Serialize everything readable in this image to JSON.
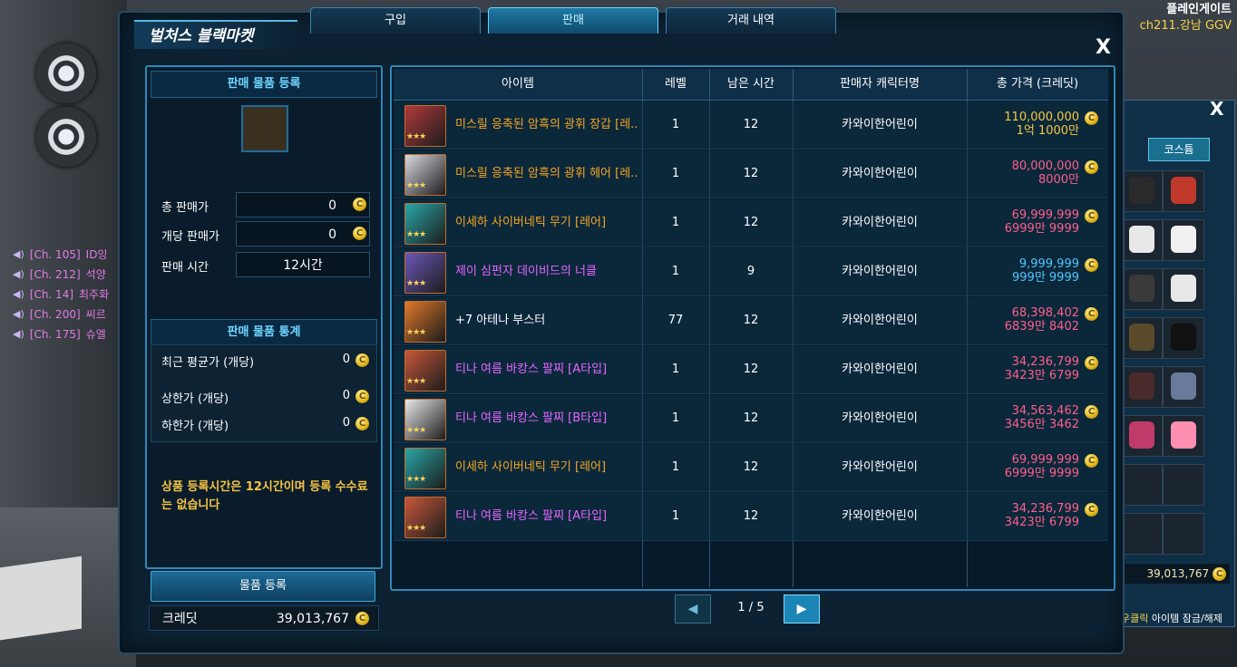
{
  "server": {
    "name": "플레인게이트",
    "channel": "ch211.강남 GGV"
  },
  "chat": [
    {
      "tag": "[Ch. 105]",
      "text": "ID잉"
    },
    {
      "tag": "[Ch. 212]",
      "text": "석양"
    },
    {
      "tag": "[Ch. 14]",
      "text": "최주화"
    },
    {
      "tag": "[Ch. 200]",
      "text": "씨르"
    },
    {
      "tag": "[Ch. 175]",
      "text": "슈엘"
    }
  ],
  "window": {
    "title": "벌처스 블랙마켓",
    "close": "X"
  },
  "tabs": [
    {
      "label": "구입"
    },
    {
      "label": "판매"
    },
    {
      "label": "거래 내역"
    }
  ],
  "left": {
    "register_header": "판매 물품 등록",
    "total_price_label": "총 판매가",
    "total_price_value": "0",
    "unit_price_label": "개당 판매가",
    "unit_price_value": "0",
    "sale_time_label": "판매 시간",
    "sale_time_value": "12시간",
    "stats_header": "판매 물품 통계",
    "recent_avg_label": "최근 평균가 (개당)",
    "recent_avg_value": "0",
    "max_label": "상한가 (개당)",
    "max_value": "0",
    "min_label": "하한가 (개당)",
    "min_value": "0",
    "notice": "상품 등록시간은 12시간이며 등록 수수료는 없습니다",
    "register_button": "물품 등록",
    "credit_label": "크레딧",
    "credit_value": "39,013,767"
  },
  "table": {
    "headers": [
      "아이템",
      "레벨",
      "남은 시간",
      "판매자 캐릭터명",
      "총 가격 (크레딧)"
    ],
    "rows": [
      {
        "name": "미스릴 응축된 암흑의 광휘 장갑 [레..",
        "level": "1",
        "time": "12",
        "seller": "카와이한어린이",
        "price": "110,000,000",
        "price_kr": "1억 1000만",
        "name_color": "#f5a623",
        "price_color": "#f5c842",
        "icon_color": "#b23a3a"
      },
      {
        "name": "미스릴 응축된 암흑의 광휘 헤어 [레..",
        "level": "1",
        "time": "12",
        "seller": "카와이한어린이",
        "price": "80,000,000",
        "price_kr": "8000만",
        "name_color": "#f5a623",
        "price_color": "#ff5f8a",
        "icon_color": "#d8d8e0"
      },
      {
        "name": "이세하 사이버네틱 무기 [레어]",
        "level": "1",
        "time": "12",
        "seller": "카와이한어린이",
        "price": "69,999,999",
        "price_kr": "6999만 9999",
        "name_color": "#f5a623",
        "price_color": "#ff5f8a",
        "icon_color": "#2aa6a6"
      },
      {
        "name": "제이 심펀자 데이비드의 너클",
        "level": "1",
        "time": "9",
        "seller": "카와이한어린이",
        "price": "9,999,999",
        "price_kr": "999만 9999",
        "name_color": "#e466ff",
        "price_color": "#4fc6ff",
        "icon_color": "#6b57b8"
      },
      {
        "name": "+7 아테나 부스터",
        "level": "77",
        "time": "12",
        "seller": "카와이한어린이",
        "price": "68,398,402",
        "price_kr": "6839만 8402",
        "name_color": "#ffffff",
        "price_color": "#ff5f8a",
        "icon_color": "#e0782a"
      },
      {
        "name": "티나 여름 바캉스 팔찌 [A타입]",
        "level": "1",
        "time": "12",
        "seller": "카와이한어린이",
        "price": "34,236,799",
        "price_kr": "3423만 6799",
        "name_color": "#e466ff",
        "price_color": "#ff5f8a",
        "icon_color": "#c8573a"
      },
      {
        "name": "티나 여름 바캉스 팔찌 [B타입]",
        "level": "1",
        "time": "12",
        "seller": "카와이한어린이",
        "price": "34,563,462",
        "price_kr": "3456만 3462",
        "name_color": "#e466ff",
        "price_color": "#ff5f8a",
        "icon_color": "#e8e8e8"
      },
      {
        "name": "이세하 사이버네틱 무기 [레어]",
        "level": "1",
        "time": "12",
        "seller": "카와이한어린이",
        "price": "69,999,999",
        "price_kr": "6999만 9999",
        "name_color": "#f5a623",
        "price_color": "#ff5f8a",
        "icon_color": "#2aa6a6"
      },
      {
        "name": "티나 여름 바캉스 팔찌 [A타입]",
        "level": "1",
        "time": "12",
        "seller": "카와이한어린이",
        "price": "34,236,799",
        "price_kr": "3423만 6799",
        "name_color": "#e466ff",
        "price_color": "#ff5f8a",
        "icon_color": "#c8573a"
      }
    ]
  },
  "pager": {
    "prev": "◀",
    "next": "▶",
    "text": "1 / 5"
  },
  "inventory": {
    "close": "X",
    "tab": "코스튬",
    "credit": "39,013,767",
    "hint_key": "우클릭",
    "hint_text": "아이템 잠금/해제"
  }
}
